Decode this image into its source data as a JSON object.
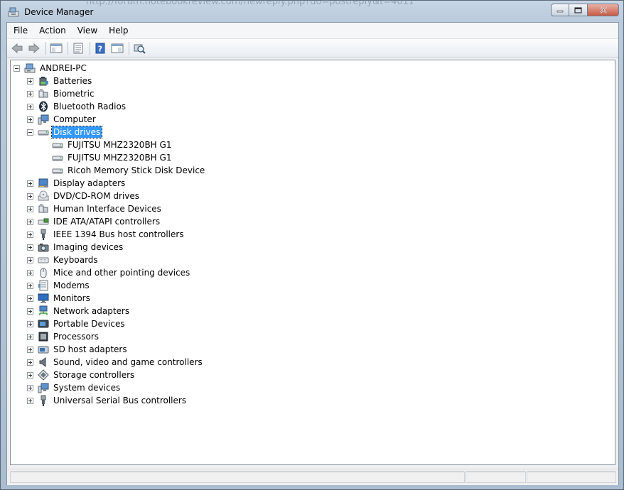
{
  "window": {
    "title": "Device Manager",
    "backdrop_text": "http://forum.notebookreview.com/newreply.php?do=postreply&t=40114"
  },
  "menu": [
    "File",
    "Action",
    "Help",
    "View"
  ],
  "menu_order": [
    "File",
    "Action",
    "View",
    "Help"
  ],
  "toolbar": [
    "back-icon",
    "forward-icon",
    "show-hide-console-tree-icon",
    "properties-icon",
    "help-icon",
    "show-action-pane-icon",
    "scan-hardware-changes-icon"
  ],
  "tree": {
    "root": "ANDREI-PC",
    "categories": [
      {
        "label": "Batteries",
        "icon": "battery-icon"
      },
      {
        "label": "Biometric",
        "icon": "biometric-icon"
      },
      {
        "label": "Bluetooth Radios",
        "icon": "bluetooth-icon"
      },
      {
        "label": "Computer",
        "icon": "computer-icon"
      },
      {
        "label": "Disk drives",
        "icon": "disk-drive-icon",
        "expanded": true,
        "selected": true,
        "children": [
          "FUJITSU MHZ2320BH G1",
          "FUJITSU MHZ2320BH G1",
          "Ricoh Memory Stick Disk Device"
        ]
      },
      {
        "label": "Display adapters",
        "icon": "display-adapter-icon"
      },
      {
        "label": "DVD/CD-ROM drives",
        "icon": "dvd-drive-icon"
      },
      {
        "label": "Human Interface Devices",
        "icon": "hid-icon"
      },
      {
        "label": "IDE ATA/ATAPI controllers",
        "icon": "ide-controller-icon"
      },
      {
        "label": "IEEE 1394 Bus host controllers",
        "icon": "ieee1394-icon"
      },
      {
        "label": "Imaging devices",
        "icon": "camera-icon"
      },
      {
        "label": "Keyboards",
        "icon": "keyboard-icon"
      },
      {
        "label": "Mice and other pointing devices",
        "icon": "mouse-icon"
      },
      {
        "label": "Modems",
        "icon": "modem-icon"
      },
      {
        "label": "Monitors",
        "icon": "monitor-icon"
      },
      {
        "label": "Network adapters",
        "icon": "network-adapter-icon"
      },
      {
        "label": "Portable Devices",
        "icon": "portable-device-icon"
      },
      {
        "label": "Processors",
        "icon": "processor-icon"
      },
      {
        "label": "SD host adapters",
        "icon": "sd-card-icon"
      },
      {
        "label": "Sound, video and game controllers",
        "icon": "speaker-icon"
      },
      {
        "label": "Storage controllers",
        "icon": "storage-controller-icon"
      },
      {
        "label": "System devices",
        "icon": "system-device-icon"
      },
      {
        "label": "Universal Serial Bus controllers",
        "icon": "usb-icon"
      }
    ]
  },
  "colors": {
    "selection": "#3399ff",
    "window_frame": "#b9cadb"
  }
}
